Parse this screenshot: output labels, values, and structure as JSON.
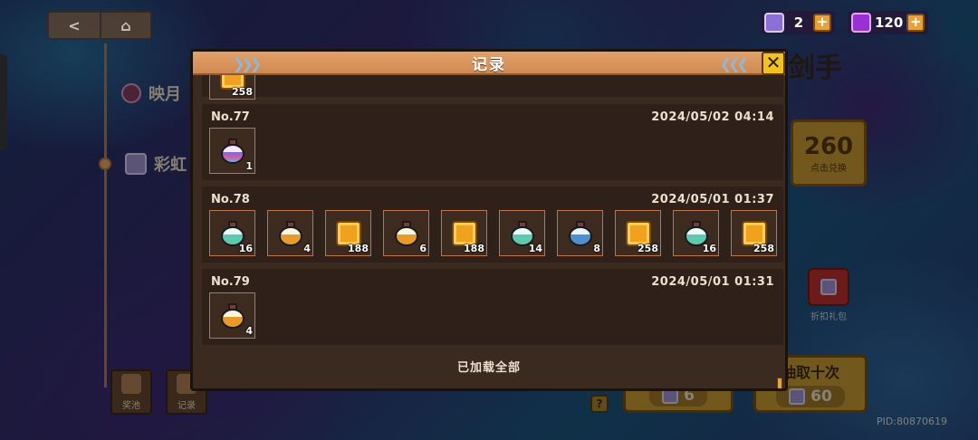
{
  "hud": {
    "back_label": "<",
    "home_label": "⌂",
    "ticket_count": "2",
    "gem_count": "120",
    "plus_label": "+"
  },
  "background": {
    "left_item_1": "映月",
    "left_item_2": "彩虹",
    "title_partial": "剑手",
    "exchange_value": "260",
    "exchange_label": "点击兑换",
    "gift_label": "折扣礼包",
    "draw_ten_label": "抽取十次",
    "draw_one_cost": "6",
    "draw_ten_cost": "60",
    "pool_label": "奖池",
    "records_label": "记录",
    "help_label": "?",
    "pid": "PID:80870619"
  },
  "modal": {
    "title": "记录",
    "close_label": "✕",
    "footer": "已加载全部",
    "partial_top_qty": "258",
    "records": [
      {
        "no": "No.77",
        "time": "2024/05/02 04:14",
        "items": [
          {
            "kind": "potion",
            "color": "rainbow",
            "qty": "1"
          }
        ]
      },
      {
        "no": "No.78",
        "time": "2024/05/01 01:37",
        "items": [
          {
            "kind": "potion",
            "color": "teal",
            "qty": "16"
          },
          {
            "kind": "potion",
            "color": "orange",
            "qty": "4"
          },
          {
            "kind": "coin",
            "color": "gold",
            "qty": "188"
          },
          {
            "kind": "potion",
            "color": "orange",
            "qty": "6"
          },
          {
            "kind": "coin",
            "color": "gold",
            "qty": "188"
          },
          {
            "kind": "potion",
            "color": "teal",
            "qty": "14"
          },
          {
            "kind": "potion",
            "color": "blue",
            "qty": "8"
          },
          {
            "kind": "coin",
            "color": "gold",
            "qty": "258"
          },
          {
            "kind": "potion",
            "color": "teal",
            "qty": "16"
          },
          {
            "kind": "coin",
            "color": "gold",
            "qty": "258"
          }
        ]
      },
      {
        "no": "No.79",
        "time": "2024/05/01 01:31",
        "items": [
          {
            "kind": "potion",
            "color": "orange",
            "qty": "4"
          }
        ]
      }
    ]
  }
}
